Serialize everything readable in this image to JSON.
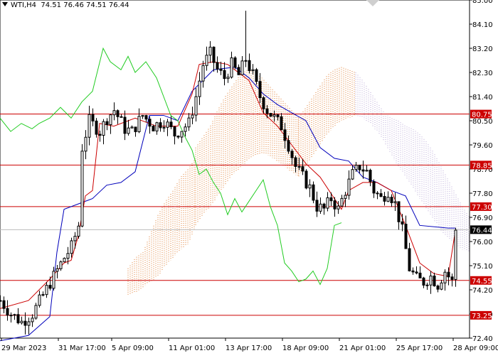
{
  "header": {
    "symbol": "WTI,H4",
    "open": "74.51",
    "high": "76.46",
    "low": "74.51",
    "close": "76.44"
  },
  "colors": {
    "background": "#ffffff",
    "candle": "#000000",
    "tenkan": "#cc0000",
    "kijun": "#0000bb",
    "chikou": "#22cc22",
    "kumo_bull": "#e07a2a",
    "kumo_bear": "#b9a6d6",
    "level_line": "#cc0000",
    "level_badge": "#cc0000",
    "price_badge": "#000000"
  },
  "chart_data": {
    "type": "candlestick",
    "instrument": "WTI",
    "timeframe": "H4",
    "indicators": [
      "Ichimoku Kinko Hyo"
    ],
    "ylim": [
      72.4,
      85.0
    ],
    "y_ticks": [
      "85.00",
      "84.10",
      "83.20",
      "82.30",
      "81.40",
      "80.50",
      "79.60",
      "78.70",
      "77.80",
      "76.90",
      "76.00",
      "75.10",
      "74.20",
      "73.30",
      "72.40"
    ],
    "x_ticks": [
      "29 Mar 2023",
      "31 Mar 17:00",
      "5 Apr 09:00",
      "11 Apr 01:00",
      "13 Apr 17:00",
      "18 Apr 09:00",
      "21 Apr 01:00",
      "25 Apr 17:00",
      "28 Apr 09:00"
    ],
    "levels": [
      80.75,
      78.85,
      77.3,
      74.55,
      73.25
    ],
    "level_labels": [
      "80.75",
      "78.85",
      "77.30",
      "74.55",
      "73.25"
    ],
    "current_price": 76.44,
    "current_price_label": "76.44",
    "close_path": [
      [
        0,
        73.8
      ],
      [
        3,
        73.3
      ],
      [
        6,
        73.0
      ],
      [
        9,
        73.3
      ],
      [
        12,
        74.0
      ],
      [
        15,
        74.7
      ],
      [
        18,
        75.4
      ],
      [
        20,
        75.8
      ],
      [
        22,
        76.6
      ],
      [
        23,
        79.5
      ],
      [
        25,
        80.5
      ],
      [
        28,
        80.1
      ],
      [
        30,
        80.6
      ],
      [
        32,
        80.9
      ],
      [
        35,
        80.2
      ],
      [
        37,
        80.1
      ],
      [
        40,
        80.7
      ],
      [
        43,
        80.3
      ],
      [
        46,
        80.5
      ],
      [
        49,
        80.0
      ],
      [
        51,
        80.2
      ],
      [
        53,
        80.4
      ],
      [
        55,
        81.4
      ],
      [
        57,
        82.6
      ],
      [
        59,
        83.0
      ],
      [
        61,
        82.4
      ],
      [
        63,
        82.1
      ],
      [
        65,
        82.6
      ],
      [
        67,
        82.2
      ],
      [
        69,
        82.8
      ],
      [
        71,
        82.2
      ],
      [
        73,
        81.4
      ],
      [
        75,
        80.9
      ],
      [
        77,
        80.6
      ],
      [
        79,
        80.3
      ],
      [
        81,
        79.6
      ],
      [
        83,
        78.8
      ],
      [
        85,
        78.4
      ],
      [
        87,
        78.0
      ],
      [
        89,
        77.3
      ],
      [
        91,
        77.2
      ],
      [
        93,
        77.6
      ],
      [
        95,
        77.2
      ],
      [
        97,
        77.9
      ],
      [
        99,
        78.5
      ],
      [
        101,
        78.8
      ],
      [
        103,
        78.6
      ],
      [
        105,
        77.9
      ],
      [
        107,
        77.6
      ],
      [
        109,
        77.9
      ],
      [
        111,
        77.4
      ],
      [
        113,
        76.4
      ],
      [
        115,
        75.0
      ],
      [
        117,
        74.6
      ],
      [
        119,
        74.5
      ],
      [
        121,
        74.7
      ],
      [
        123,
        74.4
      ],
      [
        125,
        74.9
      ],
      [
        127,
        74.5
      ],
      [
        128,
        76.44
      ]
    ],
    "tenkan_path": [
      [
        0,
        73.5
      ],
      [
        8,
        73.8
      ],
      [
        14,
        74.6
      ],
      [
        18,
        75.2
      ],
      [
        20,
        75.3
      ],
      [
        22,
        76.2
      ],
      [
        24,
        77.7
      ],
      [
        26,
        77.9
      ],
      [
        28,
        80.4
      ],
      [
        32,
        80.3
      ],
      [
        38,
        80.6
      ],
      [
        44,
        80.3
      ],
      [
        50,
        80.3
      ],
      [
        54,
        81.5
      ],
      [
        56,
        82.6
      ],
      [
        60,
        82.7
      ],
      [
        64,
        82.6
      ],
      [
        70,
        82.0
      ],
      [
        74,
        80.8
      ],
      [
        78,
        80.3
      ],
      [
        82,
        79.6
      ],
      [
        86,
        78.9
      ],
      [
        90,
        78.4
      ],
      [
        94,
        77.6
      ],
      [
        96,
        77.2
      ],
      [
        98,
        77.9
      ],
      [
        102,
        78.2
      ],
      [
        106,
        78.2
      ],
      [
        110,
        77.9
      ],
      [
        114,
        76.6
      ],
      [
        118,
        75.2
      ],
      [
        122,
        74.8
      ],
      [
        126,
        74.7
      ],
      [
        128,
        76.4
      ]
    ],
    "kijun_path": [
      [
        0,
        72.3
      ],
      [
        8,
        72.5
      ],
      [
        14,
        73.2
      ],
      [
        16,
        75.6
      ],
      [
        18,
        77.2
      ],
      [
        22,
        77.4
      ],
      [
        26,
        77.6
      ],
      [
        30,
        78.1
      ],
      [
        34,
        78.2
      ],
      [
        38,
        78.6
      ],
      [
        42,
        80.7
      ],
      [
        46,
        80.7
      ],
      [
        50,
        80.5
      ],
      [
        54,
        81.6
      ],
      [
        60,
        82.4
      ],
      [
        66,
        82.5
      ],
      [
        70,
        82.1
      ],
      [
        74,
        81.5
      ],
      [
        78,
        81.1
      ],
      [
        82,
        80.8
      ],
      [
        86,
        80.5
      ],
      [
        90,
        79.5
      ],
      [
        94,
        79.1
      ],
      [
        98,
        79.0
      ],
      [
        102,
        78.4
      ],
      [
        106,
        78.2
      ],
      [
        110,
        77.9
      ],
      [
        114,
        77.7
      ],
      [
        118,
        76.6
      ],
      [
        126,
        76.5
      ],
      [
        128,
        76.5
      ]
    ],
    "chikou_path": [
      [
        0,
        80.6
      ],
      [
        3,
        80.1
      ],
      [
        6,
        80.4
      ],
      [
        9,
        80.2
      ],
      [
        11,
        80.4
      ],
      [
        14,
        80.6
      ],
      [
        17,
        81.0
      ],
      [
        20,
        80.6
      ],
      [
        23,
        81.2
      ],
      [
        26,
        81.6
      ],
      [
        29,
        83.2
      ],
      [
        31,
        82.7
      ],
      [
        34,
        82.4
      ],
      [
        36,
        82.9
      ],
      [
        38,
        82.3
      ],
      [
        41,
        82.7
      ],
      [
        44,
        82.1
      ],
      [
        46,
        81.4
      ],
      [
        48,
        80.7
      ],
      [
        50,
        80.5
      ],
      [
        52,
        79.9
      ],
      [
        54,
        79.4
      ],
      [
        56,
        78.5
      ],
      [
        58,
        78.7
      ],
      [
        60,
        78.2
      ],
      [
        62,
        77.8
      ],
      [
        64,
        77.0
      ],
      [
        66,
        77.6
      ],
      [
        68,
        77.1
      ],
      [
        70,
        77.5
      ],
      [
        72,
        77.9
      ],
      [
        74,
        78.3
      ],
      [
        76,
        77.3
      ],
      [
        78,
        76.6
      ],
      [
        80,
        75.2
      ],
      [
        82,
        74.9
      ],
      [
        84,
        74.5
      ],
      [
        86,
        74.6
      ],
      [
        88,
        74.9
      ],
      [
        90,
        74.4
      ],
      [
        92,
        75.0
      ],
      [
        94,
        76.6
      ],
      [
        96,
        76.7
      ]
    ],
    "kumo_segments": [
      {
        "from": 36,
        "to": 55,
        "a": [
          75.0,
          75.4,
          75.6,
          76.3,
          77.0,
          77.5,
          77.9,
          78.4,
          78.7,
          79.1
        ],
        "b": [
          74.0,
          74.1,
          74.3,
          74.5,
          74.7,
          75.1,
          75.4,
          75.7,
          75.9,
          76.6
        ],
        "shade": "bull"
      },
      {
        "from": 55,
        "to": 84,
        "a": [
          79.5,
          79.9,
          80.3,
          80.9,
          81.4,
          81.8,
          82.2,
          82.4,
          82.3,
          82.1,
          81.8,
          81.5,
          81.2,
          80.9,
          80.6
        ],
        "b": [
          76.6,
          77.0,
          77.3,
          77.7,
          78.1,
          78.5,
          78.7,
          79.0,
          79.2,
          79.3,
          79.2,
          79.0,
          78.8,
          78.6,
          78.4
        ],
        "shade": "bull"
      },
      {
        "from": 84,
        "to": 100,
        "a": [
          80.6,
          81.0,
          81.4,
          81.8,
          82.2,
          82.4,
          82.5,
          82.4,
          82.3
        ],
        "b": [
          78.4,
          78.8,
          79.2,
          79.6,
          80.0,
          80.3,
          80.5,
          80.6,
          80.7
        ],
        "shade": "bull"
      },
      {
        "from": 100,
        "to": 132,
        "a": [
          80.7,
          80.6,
          80.4,
          80.1,
          79.7,
          79.2,
          78.8,
          78.4,
          78.0,
          77.6,
          77.2,
          76.8,
          76.4,
          76.1,
          75.9,
          75.7,
          75.6
        ],
        "b": [
          82.3,
          82.0,
          81.6,
          81.2,
          80.8,
          80.6,
          80.5,
          80.3,
          80.2,
          80.0,
          79.7,
          79.3,
          78.8,
          78.3,
          77.8,
          77.3,
          76.9
        ],
        "shade": "bear"
      }
    ]
  }
}
